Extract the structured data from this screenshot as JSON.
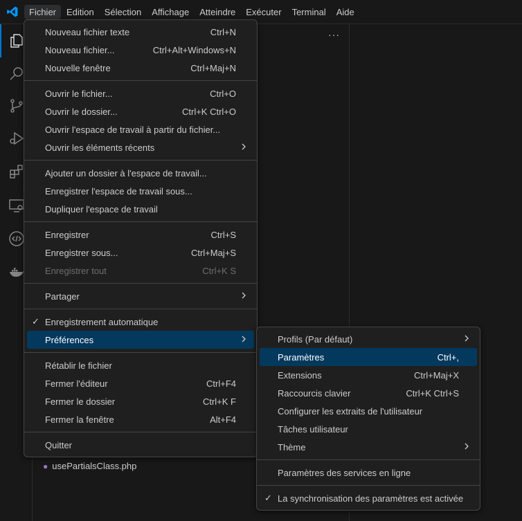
{
  "menubar": {
    "items": [
      "Fichier",
      "Edition",
      "Sélection",
      "Affichage",
      "Atteindre",
      "Exécuter",
      "Terminal",
      "Aide"
    ]
  },
  "sidebar": {
    "more": "···",
    "file": "usePartialsClass.php"
  },
  "file_menu": [
    {
      "label": "Nouveau fichier texte",
      "shortcut": "Ctrl+N"
    },
    {
      "label": "Nouveau fichier...",
      "shortcut": "Ctrl+Alt+Windows+N"
    },
    {
      "label": "Nouvelle fenêtre",
      "shortcut": "Ctrl+Maj+N"
    },
    {
      "sep": true
    },
    {
      "label": "Ouvrir le fichier...",
      "shortcut": "Ctrl+O"
    },
    {
      "label": "Ouvrir le dossier...",
      "shortcut": "Ctrl+K Ctrl+O"
    },
    {
      "label": "Ouvrir l'espace de travail à partir du fichier..."
    },
    {
      "label": "Ouvrir les éléments récents",
      "submenu": true
    },
    {
      "sep": true
    },
    {
      "label": "Ajouter un dossier à l'espace de travail..."
    },
    {
      "label": "Enregistrer l'espace de travail sous..."
    },
    {
      "label": "Dupliquer l'espace de travail"
    },
    {
      "sep": true
    },
    {
      "label": "Enregistrer",
      "shortcut": "Ctrl+S"
    },
    {
      "label": "Enregistrer sous...",
      "shortcut": "Ctrl+Maj+S"
    },
    {
      "label": "Enregistrer tout",
      "shortcut": "Ctrl+K S",
      "disabled": true
    },
    {
      "sep": true
    },
    {
      "label": "Partager",
      "submenu": true
    },
    {
      "sep": true
    },
    {
      "label": "Enregistrement automatique",
      "checked": true
    },
    {
      "label": "Préférences",
      "submenu": true,
      "highlighted": true
    },
    {
      "sep": true
    },
    {
      "label": "Rétablir le fichier"
    },
    {
      "label": "Fermer l'éditeur",
      "shortcut": "Ctrl+F4"
    },
    {
      "label": "Fermer le dossier",
      "shortcut": "Ctrl+K F"
    },
    {
      "label": "Fermer la fenêtre",
      "shortcut": "Alt+F4"
    },
    {
      "sep": true
    },
    {
      "label": "Quitter"
    }
  ],
  "pref_menu": [
    {
      "label": "Profils (Par défaut)",
      "submenu": true
    },
    {
      "label": "Paramètres",
      "shortcut": "Ctrl+,",
      "highlighted": true
    },
    {
      "label": "Extensions",
      "shortcut": "Ctrl+Maj+X"
    },
    {
      "label": "Raccourcis clavier",
      "shortcut": "Ctrl+K Ctrl+S"
    },
    {
      "label": "Configurer les extraits de l'utilisateur"
    },
    {
      "label": "Tâches utilisateur"
    },
    {
      "label": "Thème",
      "submenu": true
    },
    {
      "sep": true
    },
    {
      "label": "Paramètres des services en ligne"
    },
    {
      "sep": true
    },
    {
      "label": "La synchronisation des paramètres est activée",
      "checked": true
    }
  ]
}
